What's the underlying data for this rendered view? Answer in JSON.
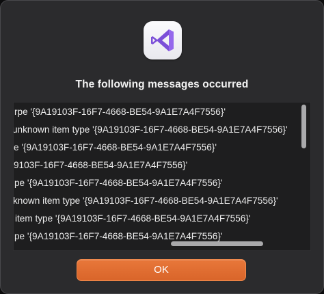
{
  "dialog": {
    "icon": "visual-studio-icon",
    "title": "The following messages occurred",
    "messages": [
      "rpe '{9A19103F-16F7-4668-BE54-9A1E7A4F7556}'",
      "unknown item type '{9A19103F-16F7-4668-BE54-9A1E7A4F7556}'",
      "e '{9A19103F-16F7-4668-BE54-9A1E7A4F7556}'",
      "9103F-16F7-4668-BE54-9A1E7A4F7556}'",
      "pe '{9A19103F-16F7-4668-BE54-9A1E7A4F7556}'",
      "known item type '{9A19103F-16F7-4668-BE54-9A1E7A4F7556}'",
      "item type '{9A19103F-16F7-4668-BE54-9A1E7A4F7556}'",
      "pe '{9A19103F-16F7-4668-BE54-9A1E7A4F7556}'"
    ],
    "ok_label": "OK",
    "colors": {
      "accent": "#e06f32",
      "icon_purple": "#7b4fd8"
    }
  }
}
